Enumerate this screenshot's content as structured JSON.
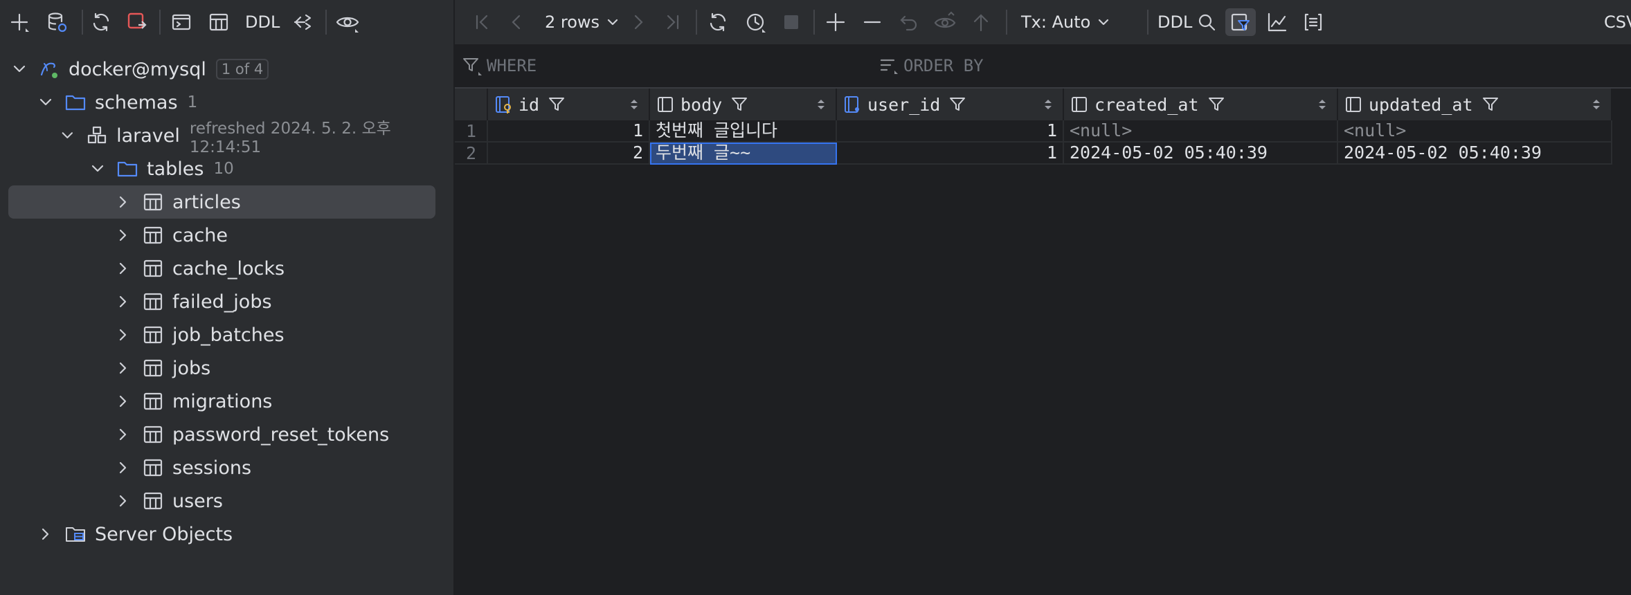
{
  "left_toolbar": {
    "ddl_label": "DDL"
  },
  "tree": {
    "connection": {
      "label": "docker@mysql",
      "badge": "1 of 4"
    },
    "schemas": {
      "label": "schemas",
      "count": "1"
    },
    "schema": {
      "label": "laravel",
      "refreshed": "refreshed 2024. 5. 2. 오후 12:14:51"
    },
    "tables": {
      "label": "tables",
      "count": "10"
    },
    "table_items": [
      "articles",
      "cache",
      "cache_locks",
      "failed_jobs",
      "job_batches",
      "jobs",
      "migrations",
      "password_reset_tokens",
      "sessions",
      "users"
    ],
    "server_objects": "Server Objects"
  },
  "right_toolbar": {
    "rows_label": "2 rows",
    "tx_label": "Tx: Auto",
    "ddl_label": "DDL",
    "export_label": "CSV"
  },
  "filter": {
    "where_label": "WHERE",
    "order_label": "ORDER BY"
  },
  "grid": {
    "columns": [
      "id",
      "body",
      "user_id",
      "created_at",
      "updated_at"
    ],
    "rows": [
      {
        "num": "1",
        "cells": [
          "1",
          "첫번째 글입니다",
          "1",
          "<null>",
          "<null>"
        ]
      },
      {
        "num": "2",
        "cells": [
          "2",
          "두번째 글~~",
          "1",
          "2024-05-02 05:40:39",
          "2024-05-02 05:40:39"
        ]
      }
    ]
  },
  "colors": {
    "accent": "#3574f0",
    "selection": "#2e4a7f",
    "folder": "#548af7",
    "table_icon": "#ced0d6"
  }
}
